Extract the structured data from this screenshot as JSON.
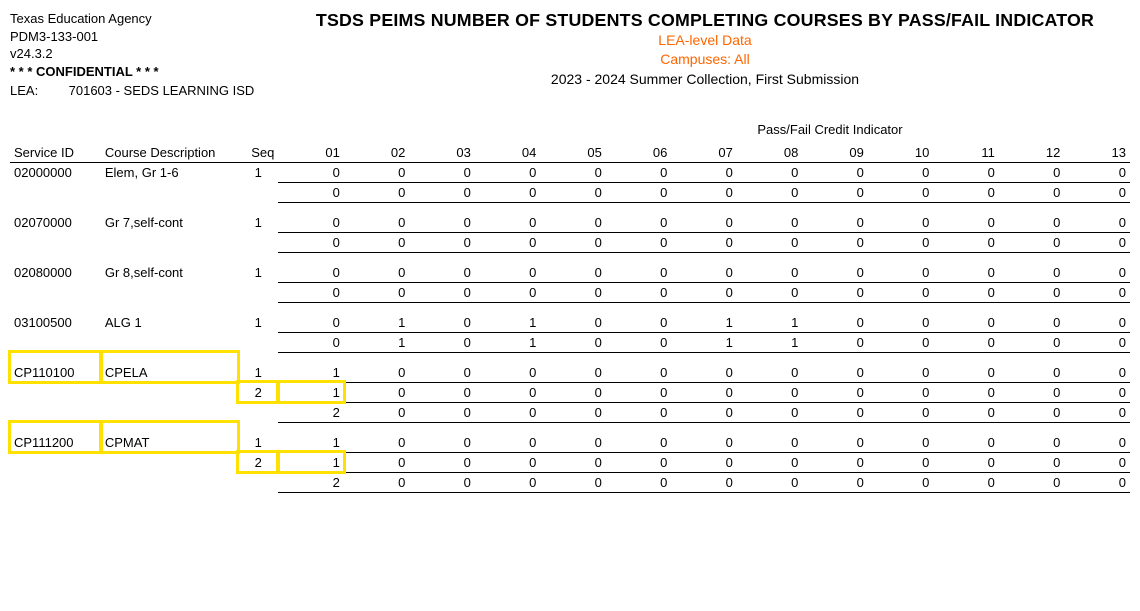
{
  "header": {
    "agency": "Texas Education Agency",
    "report_id": "PDM3-133-001",
    "version": "v24.3.2",
    "confidential": "* * * CONFIDENTIAL * * *",
    "lea_label": "LEA:",
    "lea_value": "701603 - SEDS LEARNING ISD",
    "title": "TSDS PEIMS NUMBER OF STUDENTS COMPLETING COURSES BY PASS/FAIL INDICATOR",
    "subtitle1": "LEA-level Data",
    "subtitle2": "Campuses:  All",
    "collection": "2023 - 2024 Summer Collection, First Submission"
  },
  "columns": {
    "group_label": "Pass/Fail Credit Indicator",
    "service_id": "Service ID",
    "course_desc": "Course Description",
    "seq": "Seq",
    "nums": [
      "01",
      "02",
      "03",
      "04",
      "05",
      "06",
      "07",
      "08",
      "09",
      "10",
      "11",
      "12",
      "13"
    ]
  },
  "rows": [
    {
      "service_id": "02000000",
      "desc": "Elem, Gr 1-6",
      "seqs": [
        {
          "seq": "1",
          "vals": [
            0,
            0,
            0,
            0,
            0,
            0,
            0,
            0,
            0,
            0,
            0,
            0,
            0
          ]
        }
      ],
      "totals": [
        0,
        0,
        0,
        0,
        0,
        0,
        0,
        0,
        0,
        0,
        0,
        0,
        0
      ],
      "highlight_left": false
    },
    {
      "service_id": "02070000",
      "desc": "Gr 7,self-cont",
      "seqs": [
        {
          "seq": "1",
          "vals": [
            0,
            0,
            0,
            0,
            0,
            0,
            0,
            0,
            0,
            0,
            0,
            0,
            0
          ]
        }
      ],
      "totals": [
        0,
        0,
        0,
        0,
        0,
        0,
        0,
        0,
        0,
        0,
        0,
        0,
        0
      ],
      "highlight_left": false
    },
    {
      "service_id": "02080000",
      "desc": "Gr 8,self-cont",
      "seqs": [
        {
          "seq": "1",
          "vals": [
            0,
            0,
            0,
            0,
            0,
            0,
            0,
            0,
            0,
            0,
            0,
            0,
            0
          ]
        }
      ],
      "totals": [
        0,
        0,
        0,
        0,
        0,
        0,
        0,
        0,
        0,
        0,
        0,
        0,
        0
      ],
      "highlight_left": false
    },
    {
      "service_id": "03100500",
      "desc": "ALG 1",
      "seqs": [
        {
          "seq": "1",
          "vals": [
            0,
            1,
            0,
            1,
            0,
            0,
            1,
            1,
            0,
            0,
            0,
            0,
            0
          ]
        }
      ],
      "totals": [
        0,
        1,
        0,
        1,
        0,
        0,
        1,
        1,
        0,
        0,
        0,
        0,
        0
      ],
      "highlight_left": false
    },
    {
      "service_id": "CP110100",
      "desc": "CPELA",
      "seqs": [
        {
          "seq": "1",
          "vals": [
            1,
            0,
            0,
            0,
            0,
            0,
            0,
            0,
            0,
            0,
            0,
            0,
            0
          ]
        },
        {
          "seq": "2",
          "vals": [
            1,
            0,
            0,
            0,
            0,
            0,
            0,
            0,
            0,
            0,
            0,
            0,
            0
          ],
          "highlight_seq": true,
          "highlight_col1": true
        }
      ],
      "totals": [
        2,
        0,
        0,
        0,
        0,
        0,
        0,
        0,
        0,
        0,
        0,
        0,
        0
      ],
      "highlight_left": true
    },
    {
      "service_id": "CP111200",
      "desc": "CPMAT",
      "seqs": [
        {
          "seq": "1",
          "vals": [
            1,
            0,
            0,
            0,
            0,
            0,
            0,
            0,
            0,
            0,
            0,
            0,
            0
          ]
        },
        {
          "seq": "2",
          "vals": [
            1,
            0,
            0,
            0,
            0,
            0,
            0,
            0,
            0,
            0,
            0,
            0,
            0
          ],
          "highlight_seq": true,
          "highlight_col1": true
        }
      ],
      "totals": [
        2,
        0,
        0,
        0,
        0,
        0,
        0,
        0,
        0,
        0,
        0,
        0,
        0
      ],
      "highlight_left": true
    }
  ]
}
